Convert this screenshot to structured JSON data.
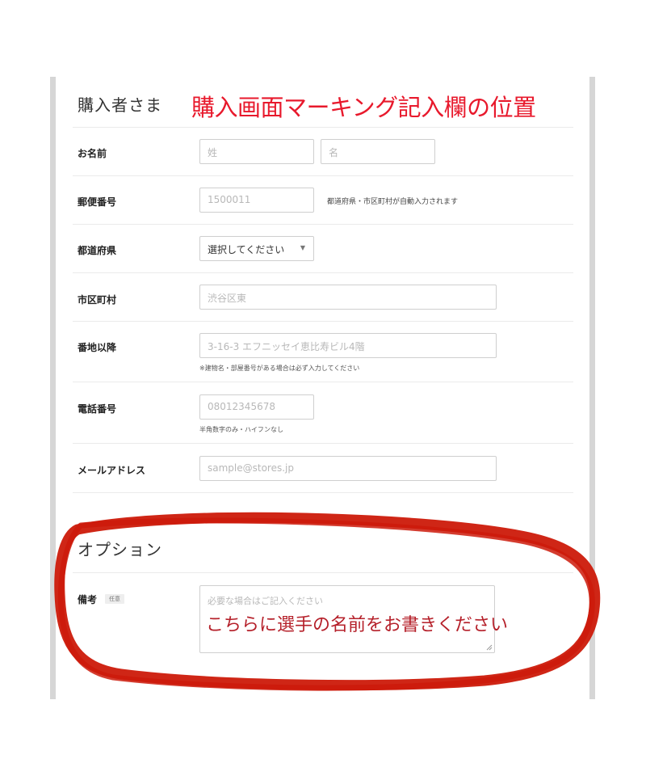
{
  "buyer_section": {
    "title": "購入者さま",
    "annotation": "購入画面マーキング記入欄の位置"
  },
  "fields": {
    "name": {
      "label": "お名前",
      "last_placeholder": "姓",
      "first_placeholder": "名"
    },
    "postal": {
      "label": "郵便番号",
      "placeholder": "1500011",
      "note": "都道府県・市区町村が自動入力されます"
    },
    "prefecture": {
      "label": "都道府県",
      "selected": "選択してください",
      "chevron_icon": "chevron-down-icon"
    },
    "city": {
      "label": "市区町村",
      "placeholder": "渋谷区東"
    },
    "street": {
      "label": "番地以降",
      "placeholder": "3-16-3 エフニッセイ恵比寿ビル4階",
      "helper": "※建物名・部屋番号がある場合は必ず入力してください"
    },
    "phone": {
      "label": "電話番号",
      "placeholder": "08012345678",
      "helper": "半角数字のみ・ハイフンなし"
    },
    "email": {
      "label": "メールアドレス",
      "placeholder": "sample@stores.jp"
    }
  },
  "option_section": {
    "title": "オプション",
    "remarks": {
      "label": "備考",
      "badge": "任意",
      "placeholder": "必要な場合はご記入ください",
      "handwritten_note": "こちらに選手の名前をお書きください"
    }
  },
  "colors": {
    "annotation_red": "#e8192c",
    "marker_red": "#cc1a0a",
    "note_red": "#b5202a"
  }
}
